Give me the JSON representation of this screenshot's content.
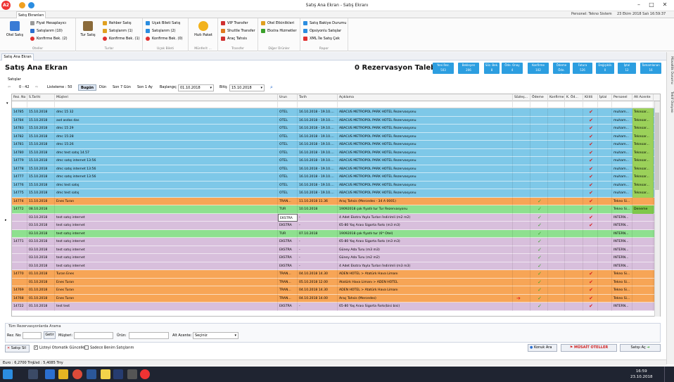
{
  "app": {
    "title": "Satış Ana Ekran - Satış Ekranı",
    "ribbon_tab": "Satış Ekranları",
    "personel": "Personel: Tekno Sistem",
    "datetime": "23 Ekim 2018 Salı 16:59:37"
  },
  "ribbon": {
    "groups": [
      {
        "title": "Oteller",
        "big": "Otel Satış",
        "items": [
          "Fiyat Hesaplayıcı",
          "Satışlarım (10)",
          "Konfirme Bek. (2)"
        ]
      },
      {
        "title": "Turlar",
        "big": "Tur Satış",
        "items": [
          "Rehber Satış",
          "Satışlarım (1)",
          "Konfirme Bek. (1)"
        ]
      },
      {
        "title": "Uçak Bileti",
        "items": [
          "Uçak Bileti Satış",
          "Satışlarım (2)",
          "Konfirme Bek. (0)"
        ]
      },
      {
        "title": "Münferit ...",
        "big": "Hızlı Paket",
        "items": []
      },
      {
        "title": "Transfer",
        "items": [
          "VIP Transfer",
          "Shuttle Transfer",
          "Araç Tahsis"
        ]
      },
      {
        "title": "Diğer Ürünler",
        "items": [
          "Otel Etkinlikleri",
          "Ekstra Hizmetler"
        ]
      },
      {
        "title": "Rapor",
        "items": [
          "Satış Bakiye Durumu",
          "Opsiyonlu Satışlar",
          "XML İle Satış Çek"
        ]
      }
    ]
  },
  "doc_tab": "Satış Ana Ekran",
  "side_tabs": [
    "Müsaitlik Durumu",
    "Teklif Dosyası"
  ],
  "page": {
    "title": "Satış Ana Ekran",
    "rez_talep": "0 Rezervasyon Talebi"
  },
  "stats": [
    {
      "label": "Yeni Rez.",
      "value": "503"
    },
    {
      "label": "Bekleyen",
      "value": "206"
    },
    {
      "label": "Söz. Bek.",
      "value": "8"
    },
    {
      "label": "Öde. Onay",
      "value": "4"
    },
    {
      "label": "Konfirme",
      "value": "102"
    },
    {
      "label": "Ödeme Öde.",
      "value": "0"
    },
    {
      "label": "Fatura",
      "value": "526"
    },
    {
      "label": "Değişiklik",
      "value": "0"
    },
    {
      "label": "İptal",
      "value": "12"
    },
    {
      "label": "Tamamlanan",
      "value": "16"
    }
  ],
  "toolbar": {
    "section": "Satışlar",
    "range": "0 - 42",
    "listeleme": "Listeleme : 50",
    "bugun": "Bugün",
    "dun": "Dün",
    "son7": "Son 7 Gün",
    "son1ay": "Son 1 Ay",
    "baslangic_label": "Başlangıç",
    "baslangic": "01.10.2018",
    "bitis_label": "Bitiş",
    "bitis": "15.10.2018"
  },
  "columns": [
    "Rez. No",
    "S.Tarihi",
    "Müşteri",
    "Urun",
    "Tarih",
    "Açıklama",
    "Sözleş...",
    "Ödeme",
    "Konfirme",
    "K. Öd...",
    "Kilitli",
    "İptal",
    "Personel",
    "Alt Acente"
  ],
  "rows": [
    {
      "color": "blue",
      "rez": "14785",
      "st": "15.10.2018",
      "mus": "dmc 15 32",
      "urun": "OTEL",
      "tarih": "16.10.2018 - 19.10....",
      "acik": "ABACUS METROPOL PARK HOTEL Rezervasyonu",
      "odeme": "",
      "kilit": "x",
      "pers": "muham...",
      "alt": "Teknoar..."
    },
    {
      "color": "blue",
      "rez": "14784",
      "st": "15.10.2018",
      "mus": "asd asdas das",
      "urun": "OTEL",
      "tarih": "16.10.2018 - 19.10....",
      "acik": "ABACUS METROPOL PARK HOTEL Rezervasyonu",
      "odeme": "",
      "kilit": "x",
      "pers": "muham...",
      "alt": "Teknoar..."
    },
    {
      "color": "blue",
      "rez": "14783",
      "st": "15.10.2018",
      "mus": "dmc 15 29",
      "urun": "OTEL",
      "tarih": "16.10.2018 - 19.10....",
      "acik": "ABACUS METROPOL PARK HOTEL Rezervasyonu",
      "odeme": "",
      "kilit": "x",
      "pers": "muham...",
      "alt": "Teknoar..."
    },
    {
      "color": "blue",
      "rez": "14782",
      "st": "15.10.2018",
      "mus": "dmc 15:28",
      "urun": "OTEL",
      "tarih": "16.10.2018 - 19.10....",
      "acik": "ABACUS METROPOL PARK HOTEL Rezervasyonu",
      "odeme": "",
      "kilit": "x",
      "pers": "muham...",
      "alt": "Teknoar..."
    },
    {
      "color": "blue",
      "rez": "14781",
      "st": "15.10.2018",
      "mus": "dmc 15:26",
      "urun": "OTEL",
      "tarih": "16.10.2018 - 19.10....",
      "acik": "ABACUS METROPOL PARK HOTEL Rezervasyonu",
      "odeme": "",
      "kilit": "x",
      "pers": "muham...",
      "alt": "Teknoar..."
    },
    {
      "color": "blue",
      "rez": "14780",
      "st": "15.10.2018",
      "mus": "dmc test satış 14.57",
      "urun": "OTEL",
      "tarih": "16.10.2018 - 19.10....",
      "acik": "ABACUS METROPOL PARK HOTEL Rezervasyonu",
      "odeme": "",
      "kilit": "x",
      "pers": "muham...",
      "alt": "Teknoar..."
    },
    {
      "color": "blue",
      "rez": "14779",
      "st": "15.10.2018",
      "mus": "dmc satış internet 13:56",
      "urun": "OTEL",
      "tarih": "16.10.2018 - 19.10....",
      "acik": "ABACUS METROPOL PARK HOTEL Rezervasyonu",
      "odeme": "",
      "kilit": "x",
      "pers": "muham...",
      "alt": "Teknoar..."
    },
    {
      "color": "blue",
      "rez": "14778",
      "st": "15.10.2018",
      "mus": "dmc satış internet 13:56",
      "urun": "OTEL",
      "tarih": "16.10.2018 - 19.10....",
      "acik": "ABACUS METROPOL PARK HOTEL Rezervasyonu",
      "odeme": "",
      "kilit": "x",
      "pers": "muham...",
      "alt": "Teknoar..."
    },
    {
      "color": "blue",
      "rez": "14777",
      "st": "15.10.2018",
      "mus": "dmc satış internet 13:56",
      "urun": "OTEL",
      "tarih": "16.10.2018 - 19.10....",
      "acik": "ABACUS METROPOL PARK HOTEL Rezervasyonu",
      "odeme": "",
      "kilit": "x",
      "pers": "muham...",
      "alt": "Teknoar..."
    },
    {
      "color": "blue",
      "rez": "14776",
      "st": "15.10.2018",
      "mus": "dmc test satış",
      "urun": "OTEL",
      "tarih": "16.10.2018 - 19.10....",
      "acik": "ABACUS METROPOL PARK HOTEL Rezervasyonu",
      "odeme": "",
      "kilit": "x",
      "pers": "muham...",
      "alt": "Teknoar..."
    },
    {
      "color": "blue",
      "rez": "14775",
      "st": "15.10.2018",
      "mus": "dmc test satış",
      "urun": "OTEL",
      "tarih": "16.10.2018 - 19.10....",
      "acik": "ABACUS METROPOL PARK HOTEL Rezervasyonu",
      "odeme": "",
      "kilit": "x",
      "pers": "muham...",
      "alt": "Teknoar..."
    },
    {
      "color": "orange",
      "rez": "14774",
      "st": "11.10.2018",
      "mus": "Enes Turan",
      "urun": "TRAN...",
      "tarih": "11.10.2018 11.36",
      "acik": "Araç Tahsis (Mercedes - 34 A 0001)",
      "odeme": "v",
      "kilit": "x",
      "pers": "Tekno Si...",
      "alt": ""
    },
    {
      "color": "green",
      "rez": "14772",
      "st": "08.10.2018",
      "mus": "",
      "urun": "TUR",
      "tarih": "10.10.2018",
      "acik": "19092018 çok fiyatlı tur  Tur Rezervasyonu",
      "odeme": "v",
      "kilit": "x",
      "pers": "Tekno Si...",
      "alt": "Deneme"
    },
    {
      "color": "purple",
      "rez": "",
      "st": "03.10.2018",
      "mus": "test satış internet",
      "urun": "EKSTRA",
      "tarih": "-",
      "acik": "4 Adet Ekstra Yayla Turları İndirimli (m2 m2)",
      "odeme": "v",
      "kilit": "x",
      "pers": "INTERN...",
      "alt": "",
      "sel": true
    },
    {
      "color": "purple",
      "rez": "",
      "st": "03.10.2018",
      "mus": "test satış internet",
      "urun": "EKSTRA",
      "tarih": "-",
      "acik": "65-80 Yaş Arası Sigorta Farkı (m3 m3)",
      "odeme": "v",
      "kilit": "x",
      "pers": "INTERN...",
      "alt": ""
    },
    {
      "color": "green",
      "rez": "",
      "st": "03.10.2018",
      "mus": "test satış internet",
      "urun": "TUR",
      "tarih": "07.10.2018",
      "acik": "19092018 çok fiyatlı tur  (6* Otel)",
      "odeme": "v",
      "kilit": "",
      "pers": "INTERN...",
      "alt": ""
    },
    {
      "color": "purple",
      "rez": "14771",
      "st": "03.10.2018",
      "mus": "test satış internet",
      "urun": "EKSTRA",
      "tarih": "-",
      "acik": "65-80 Yaş Arası Sigorta Farkı (m3 m3)",
      "odeme": "v",
      "kilit": "",
      "pers": "INTERN...",
      "alt": ""
    },
    {
      "color": "purple",
      "rez": "",
      "st": "03.10.2018",
      "mus": "test satış internet",
      "urun": "EKSTRA",
      "tarih": "-",
      "acik": "Güney Ada Turu (m3 m3)",
      "odeme": "v",
      "kilit": "",
      "pers": "INTERN...",
      "alt": ""
    },
    {
      "color": "purple",
      "rez": "",
      "st": "03.10.2018",
      "mus": "test satış internet",
      "urun": "EKSTRA",
      "tarih": "-",
      "acik": "Güney Ada Turu (m2 m2)",
      "odeme": "v",
      "kilit": "",
      "pers": "INTERN...",
      "alt": ""
    },
    {
      "color": "purple",
      "rez": "",
      "st": "03.10.2018",
      "mus": "test satış internet",
      "urun": "EKSTRA",
      "tarih": "-",
      "acik": "4 Adet Ekstra Yayla Turları İndirimli (m3 m3)",
      "odeme": "v",
      "kilit": "",
      "pers": "INTERN...",
      "alt": ""
    },
    {
      "color": "orange",
      "rez": "14770",
      "st": "01.10.2018",
      "mus": "Turan Enes",
      "urun": "TRAN...",
      "tarih": "04.10.2018 14.30",
      "acik": "ADEN HOTEL > Atatürk Hava Limanı",
      "odeme": "v",
      "kilit": "x",
      "pers": "Tekno Si...",
      "alt": ""
    },
    {
      "color": "orange",
      "rez": "",
      "st": "01.10.2018",
      "mus": "Enes Turan",
      "urun": "TRAN...",
      "tarih": "05.10.2018 12.00",
      "acik": "Atatürk Hava Limanı > ADEN HOTEL",
      "odeme": "v",
      "kilit": "x",
      "pers": "Tekno Si...",
      "alt": ""
    },
    {
      "color": "orange",
      "rez": "14769",
      "st": "01.10.2018",
      "mus": "Enes Turan",
      "urun": "TRAN...",
      "tarih": "04.10.2018 14.30",
      "acik": "ADEN HOTEL > Atatürk Hava Limanı",
      "odeme": "v",
      "kilit": "x",
      "pers": "Tekno Si...",
      "alt": ""
    },
    {
      "color": "orange",
      "rez": "14768",
      "st": "01.10.2018",
      "mus": "Enes Turan",
      "urun": "TRAN...",
      "tarih": "04.10.2018 14.00",
      "acik": "Araç Tahsis (Mercedes)",
      "odeme": "v",
      "kilit": "x",
      "pers": "Tekno Si...",
      "alt": "",
      "arrow": true
    },
    {
      "color": "purple",
      "rez": "14722",
      "st": "01.10.2018",
      "mus": "test test",
      "urun": "EKSTRA",
      "tarih": "-",
      "acik": "65-80 Yaş Arası Sigorta Farkı(bisi bisi)",
      "odeme": "v",
      "kilit": "x",
      "pers": "INTERN...",
      "alt": ""
    }
  ],
  "search": {
    "title": "Tüm Rezervasyonlarda Arama",
    "rezno_label": "Rez. No:",
    "getir": "Getir",
    "musteri_label": "Müşteri:",
    "urun_label": "Ürün:",
    "altacente_label": "Alt Acente:",
    "altacente_value": "Seçiniz"
  },
  "bottom": {
    "satis_sil": "Satışı Sil",
    "otomatik": "Listeyi Otomatik Güncelle",
    "sadece": "Sadece Benim Satışlarım",
    "konuk_ara": "Konuk Ara",
    "musait": "MÜSAİT OTELLER",
    "satis_ac": "Satışı Aç"
  },
  "status": {
    "euro": "Euro : 6,2700 Trry",
    "usd": "Usd : 5,4085 Trry"
  },
  "clock": {
    "time": "16:59",
    "date": "23.10.2018"
  }
}
